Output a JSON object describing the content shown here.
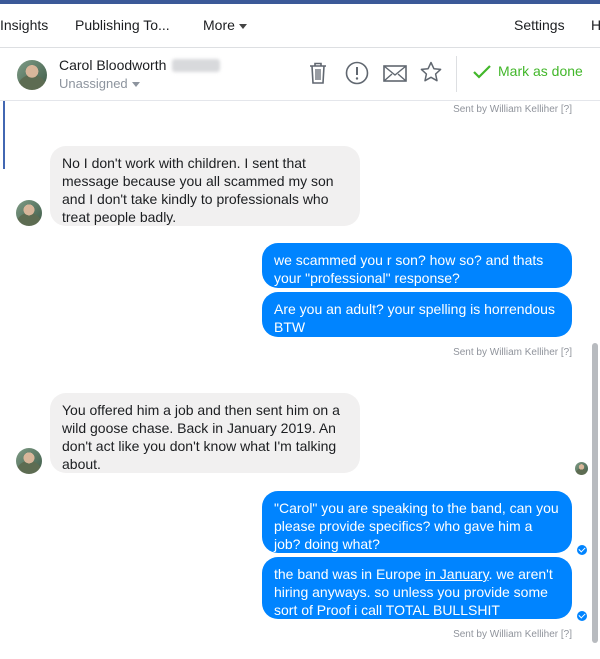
{
  "nav": {
    "insights": "Insights",
    "publishing_tools": "Publishing To...",
    "more": "More",
    "settings": "Settings",
    "help_partial": "H"
  },
  "conversation": {
    "contact_name": "Carol Bloodworth",
    "assignment": "Unassigned",
    "actions": [
      "trash-icon",
      "spam-icon",
      "mail-icon",
      "star-icon"
    ],
    "mark_done": "Mark as done"
  },
  "messages": [
    {
      "dir": "meta",
      "text": "Sent by William Kelliher [?]"
    },
    {
      "dir": "in",
      "text": "No I don't work with children. I sent that message because you all scammed my son and I don't take kindly to professionals who treat people badly."
    },
    {
      "dir": "out",
      "text": "we scammed you r son? how so? and thats your \"professional\" response?"
    },
    {
      "dir": "out",
      "text": "Are you an adult? your spelling is horrendous BTW"
    },
    {
      "dir": "meta",
      "text": "Sent by William Kelliher [?]"
    },
    {
      "dir": "in",
      "text": "You offered him a job and then sent him on a wild goose chase. Back in January 2019. An don't act like you don't know what I'm talking about."
    },
    {
      "dir": "out",
      "text": "\"Carol\" you are speaking to the band, can you please provide specifics? who gave him a job? doing what?"
    },
    {
      "dir": "out",
      "text_parts": [
        "the band was in Europe ",
        "in January",
        ". we aren't hiring anyways. so unless you provide some sort of Proof i call TOTAL BULLSHIT"
      ]
    },
    {
      "dir": "meta",
      "text": "Sent by William Kelliher [?]"
    }
  ],
  "colors": {
    "brand": "#3b5998",
    "outgoing_bubble": "#0084ff",
    "incoming_bubble": "#f1f0f0",
    "done_green": "#42b72a"
  }
}
